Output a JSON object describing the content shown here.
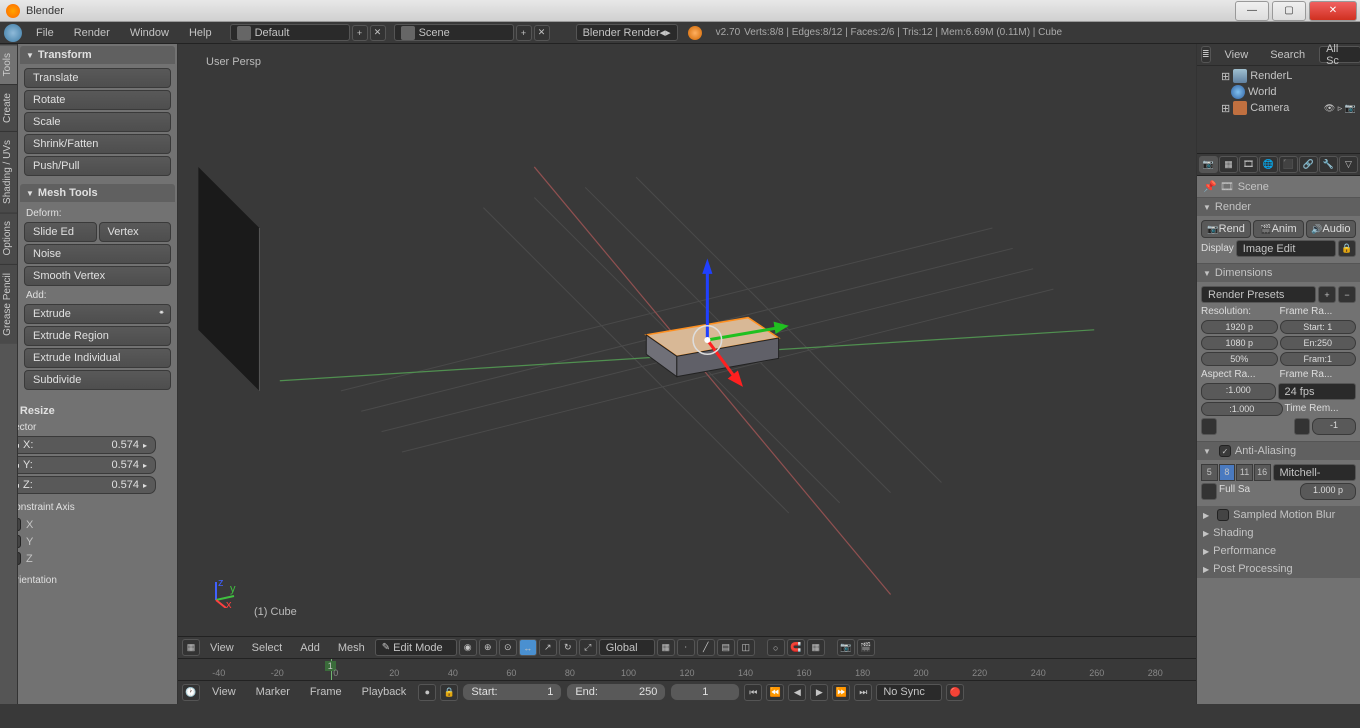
{
  "title": "Blender",
  "window_controls": {
    "min": "—",
    "max": "▢",
    "close": "✕"
  },
  "topmenu": {
    "items": [
      "File",
      "Render",
      "Window",
      "Help"
    ],
    "layout": "Default",
    "scene": "Scene",
    "engine": "Blender Render",
    "version": "v2.70",
    "stats": "Verts:8/8 | Edges:8/12 | Faces:2/6 | Tris:12 | Mem:6.69M (0.11M) | Cube"
  },
  "vtabs": [
    "Tools",
    "Create",
    "Shading / UVs",
    "Options",
    "Grease Pencil"
  ],
  "toolshelf": {
    "transform": {
      "title": "Transform",
      "buttons": [
        "Translate",
        "Rotate",
        "Scale",
        "Shrink/Fatten",
        "Push/Pull"
      ]
    },
    "meshtools": {
      "title": "Mesh Tools",
      "deform": "Deform:",
      "deform_btns": [
        "Slide Ed",
        "Vertex"
      ],
      "noise": "Noise",
      "smooth": "Smooth Vertex",
      "add": "Add:",
      "extrude": "Extrude",
      "ext_region": "Extrude Region",
      "ext_indiv": "Extrude Individual",
      "subdiv": "Subdivide"
    }
  },
  "operator": {
    "title": "Resize",
    "vector": "Vector",
    "x": {
      "label": "X:",
      "value": "0.574"
    },
    "y": {
      "label": "Y:",
      "value": "0.574"
    },
    "z": {
      "label": "Z:",
      "value": "0.574"
    },
    "constraint": "Constraint Axis",
    "cx": "X",
    "cy": "Y",
    "cz": "Z",
    "orientation": "Orientation"
  },
  "viewport": {
    "persp": "User Persp",
    "object": "(1) Cube"
  },
  "viewheader": {
    "menus": [
      "View",
      "Select",
      "Add",
      "Mesh"
    ],
    "mode": "Edit Mode",
    "orient": "Global"
  },
  "timeline": {
    "menus": [
      "View",
      "Marker",
      "Frame",
      "Playback"
    ],
    "start_label": "Start:",
    "start": "1",
    "end_label": "End:",
    "end": "250",
    "cur": "1",
    "sync": "No Sync",
    "ticks": [
      "-40",
      "-20",
      "0",
      "20",
      "40",
      "60",
      "80",
      "100",
      "120",
      "140",
      "160",
      "180",
      "200",
      "220",
      "240",
      "260",
      "280"
    ]
  },
  "outliner": {
    "header_items": [
      "View",
      "Search",
      "All Sc"
    ],
    "items": [
      {
        "name": "RenderL"
      },
      {
        "name": "World"
      },
      {
        "name": "Camera"
      }
    ]
  },
  "props": {
    "breadcrumb": "Scene",
    "render": {
      "title": "Render",
      "rend": "Rend",
      "anim": "Anim",
      "audio": "Audio",
      "display": "Display",
      "display_val": "Image Edit"
    },
    "dimensions": {
      "title": "Dimensions",
      "presets": "Render Presets",
      "res": "Resolution:",
      "fra": "Frame Ra...",
      "w": "1920 p",
      "h": "1080 p",
      "pct": "50%",
      "start": "Start: 1",
      "end": "En:250",
      "step": "Fram:1",
      "aspect": "Aspect Ra...",
      "frr": "Frame Ra...",
      "ax": ":1.000",
      "ay": ":1.000",
      "fps": "24 fps",
      "tr": "Time Rem...",
      "tr1": "-1"
    },
    "aa": {
      "title": "Anti-Aliasing",
      "samples": [
        "5",
        "8",
        "11",
        "16"
      ],
      "filter": "Mitchell-",
      "full": "Full Sa",
      "px": "1.000 p"
    },
    "collapsed": [
      "Sampled Motion Blur",
      "Shading",
      "Performance",
      "Post Processing"
    ]
  }
}
